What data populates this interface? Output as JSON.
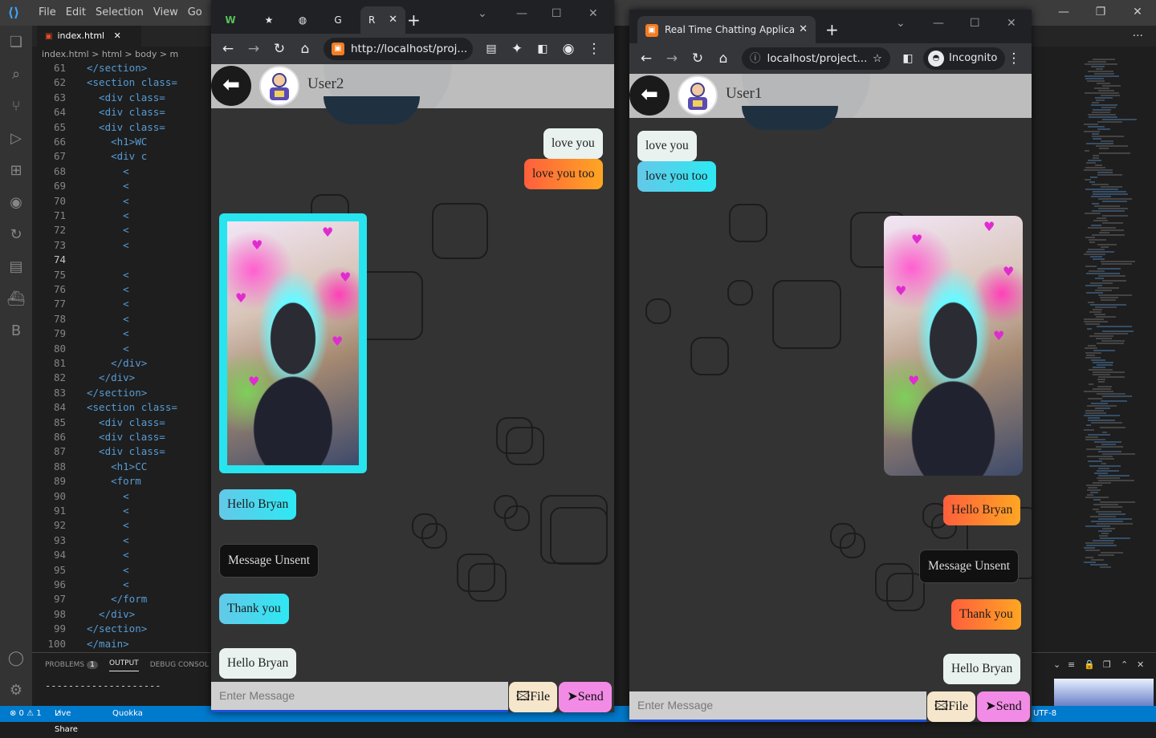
{
  "vscode": {
    "menu": [
      "File",
      "Edit",
      "Selection",
      "View",
      "Go"
    ],
    "tab_label": "index.html",
    "breadcrumb": "index.html > html > body > m",
    "lines": [
      {
        "n": "61",
        "code": "</section>"
      },
      {
        "n": "62",
        "code": "<section class="
      },
      {
        "n": "63",
        "code": "  <div class="
      },
      {
        "n": "64",
        "code": "  <div class="
      },
      {
        "n": "65",
        "code": "  <div class="
      },
      {
        "n": "66",
        "code": "    <h1>WC"
      },
      {
        "n": "67",
        "code": "    <div c"
      },
      {
        "n": "68",
        "code": "      <"
      },
      {
        "n": "69",
        "code": "      <"
      },
      {
        "n": "70",
        "code": "      <"
      },
      {
        "n": "71",
        "code": "      <"
      },
      {
        "n": "72",
        "code": "      <"
      },
      {
        "n": "73",
        "code": "      <"
      },
      {
        "n": "74",
        "code": ""
      },
      {
        "n": "75",
        "code": "      <"
      },
      {
        "n": "76",
        "code": "      <"
      },
      {
        "n": "77",
        "code": "      <"
      },
      {
        "n": "78",
        "code": "      <"
      },
      {
        "n": "79",
        "code": "      <"
      },
      {
        "n": "80",
        "code": "      <"
      },
      {
        "n": "81",
        "code": "    </div>"
      },
      {
        "n": "82",
        "code": "  </div>"
      },
      {
        "n": "83",
        "code": "</section>"
      },
      {
        "n": "84",
        "code": "<section class="
      },
      {
        "n": "85",
        "code": "  <div class="
      },
      {
        "n": "86",
        "code": "  <div class="
      },
      {
        "n": "87",
        "code": "  <div class="
      },
      {
        "n": "88",
        "code": "    <h1>CC"
      },
      {
        "n": "89",
        "code": "    <form"
      },
      {
        "n": "90",
        "code": "      <"
      },
      {
        "n": "91",
        "code": "      <"
      },
      {
        "n": "92",
        "code": "      <"
      },
      {
        "n": "93",
        "code": "      <"
      },
      {
        "n": "94",
        "code": "      <"
      },
      {
        "n": "95",
        "code": "      <"
      },
      {
        "n": "96",
        "code": "      <"
      },
      {
        "n": "97",
        "code": "    </form"
      },
      {
        "n": "98",
        "code": "  </div>"
      },
      {
        "n": "99",
        "code": "</section>"
      },
      {
        "n": "100",
        "code": "</main>"
      }
    ],
    "panel": {
      "problems_label": "PROBLEMS",
      "problems_count": "1",
      "output_label": "OUTPUT",
      "debug_label": "DEBUG CONSOL",
      "output_text": "--------------------"
    },
    "status": {
      "errors": "⊗ 0 ⚠ 1",
      "live_share": "Live Share",
      "quokka": "Quokka",
      "encoding": "UTF-8"
    }
  },
  "browser_a": {
    "tab_title": "R",
    "address": "http://localhost/proj...",
    "chat": {
      "user_name": "User2",
      "messages": {
        "m1": "love you",
        "m2": "love you too",
        "m3": "Hello Bryan",
        "m4": "Message Unsent",
        "m5": "Thank you",
        "m6": "Hello Bryan"
      },
      "input_placeholder": "Enter Message",
      "file_label": "File",
      "send_label": "Send"
    }
  },
  "browser_b": {
    "tab_title": "Real Time Chatting Applicatio",
    "address": "localhost/project...",
    "incognito_label": "Incognito",
    "chat": {
      "user_name": "User1",
      "messages": {
        "m1": "love you",
        "m2": "love you too",
        "m3": "Hello Bryan",
        "m4": "Message Unsent",
        "m5": "Thank you",
        "m6": "Hello Bryan"
      },
      "input_placeholder": "Enter Message",
      "file_label": "File",
      "send_label": "Send"
    }
  },
  "colors": {
    "vscode_status": "#007acc",
    "bubble_orange": "#ff8a2e",
    "bubble_cyan": "#2ee8f3",
    "send_button": "#f28be6",
    "file_button": "#f5e6cc"
  }
}
